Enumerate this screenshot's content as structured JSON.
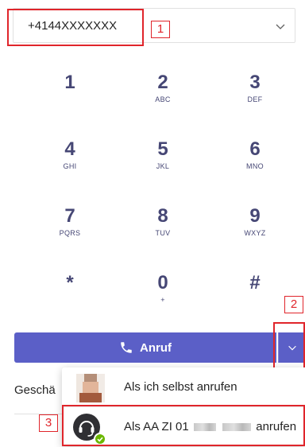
{
  "number_field": {
    "value": "+4144XXXXXXX"
  },
  "dialpad": {
    "keys": [
      {
        "digit": "1",
        "letters": ""
      },
      {
        "digit": "2",
        "letters": "ABC"
      },
      {
        "digit": "3",
        "letters": "DEF"
      },
      {
        "digit": "4",
        "letters": "GHI"
      },
      {
        "digit": "5",
        "letters": "JKL"
      },
      {
        "digit": "6",
        "letters": "MNO"
      },
      {
        "digit": "7",
        "letters": "PQRS"
      },
      {
        "digit": "8",
        "letters": "TUV"
      },
      {
        "digit": "9",
        "letters": "WXYZ"
      },
      {
        "digit": "*",
        "letters": ""
      },
      {
        "digit": "0",
        "letters": "+"
      },
      {
        "digit": "#",
        "letters": ""
      }
    ]
  },
  "call_button": {
    "label": "Anruf"
  },
  "background": {
    "partial_label": "Geschä"
  },
  "menu": {
    "items": [
      {
        "label": "Als ich selbst anrufen"
      },
      {
        "label_prefix": "Als AA ZI 01",
        "label_suffix": "anrufen"
      }
    ]
  },
  "annotations": [
    "1",
    "2",
    "3"
  ],
  "colors": {
    "accent": "#5b5fc7",
    "dial_text": "#464775",
    "annotation": "#e0252b",
    "presence": "#6bb700"
  },
  "icons": {
    "number_dropdown": "chevron-down-icon",
    "call": "phone-icon",
    "call_dropdown": "chevron-down-icon",
    "presence": "checkmark-icon",
    "call_queue": "headset-icon"
  }
}
